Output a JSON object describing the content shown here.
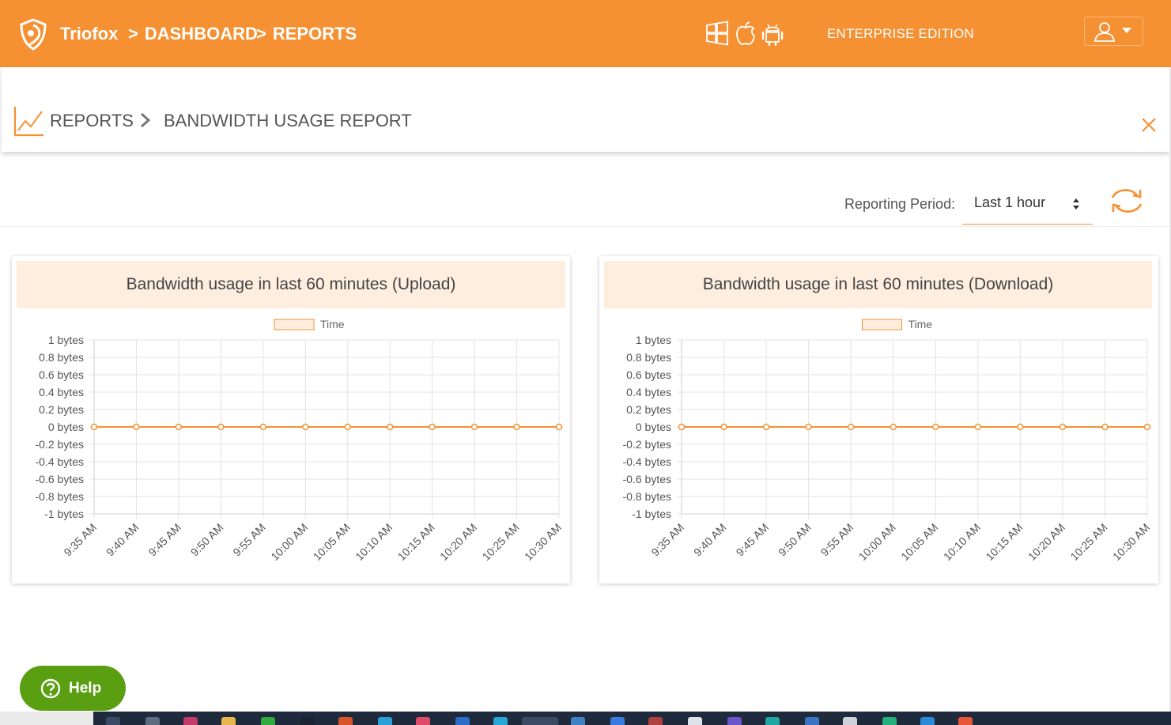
{
  "header": {
    "brand": "Triofox",
    "breadcrumb": [
      "DASHBOARD",
      "REPORTS"
    ],
    "breadcrumb_separator": ">",
    "platform_icons": [
      "windows-icon",
      "apple-icon",
      "android-icon"
    ],
    "edition": "ENTERPRISE EDITION",
    "user_menu_icon": "user-icon"
  },
  "page": {
    "breadcrumb": [
      "REPORTS",
      "BANDWIDTH USAGE REPORT"
    ],
    "icon": "line-chart-icon"
  },
  "toolbar": {
    "reporting_period_label": "Reporting Period:",
    "reporting_period_value": "Last 1 hour",
    "refresh_icon": "refresh-icon"
  },
  "help": {
    "label": "Help"
  },
  "colors": {
    "accent": "#f59132",
    "header_bg": "#f59132",
    "card_head_bg": "#fdeee0",
    "help_green": "#5a9e12",
    "line": "#f59132"
  },
  "chart_data": [
    {
      "type": "line",
      "title": "Bandwidth usage in last 60 minutes (Upload)",
      "x": [
        "9:35 AM",
        "9:40 AM",
        "9:45 AM",
        "9:50 AM",
        "9:55 AM",
        "10:00 AM",
        "10:05 AM",
        "10:10 AM",
        "10:15 AM",
        "10:20 AM",
        "10:25 AM",
        "10:30 AM"
      ],
      "series": [
        {
          "name": "Time",
          "values": [
            0,
            0,
            0,
            0,
            0,
            0,
            0,
            0,
            0,
            0,
            0,
            0
          ]
        }
      ],
      "ylim": [
        -1,
        1
      ],
      "yticks": [
        "1 bytes",
        "0.8 bytes",
        "0.6 bytes",
        "0.4 bytes",
        "0.2 bytes",
        "0 bytes",
        "-0.2 bytes",
        "-0.4 bytes",
        "-0.6 bytes",
        "-0.8 bytes",
        "-1 bytes"
      ],
      "grid": true,
      "legend": "top-center"
    },
    {
      "type": "line",
      "title": "Bandwidth usage in last 60 minutes (Download)",
      "x": [
        "9:35 AM",
        "9:40 AM",
        "9:45 AM",
        "9:50 AM",
        "9:55 AM",
        "10:00 AM",
        "10:05 AM",
        "10:10 AM",
        "10:15 AM",
        "10:20 AM",
        "10:25 AM",
        "10:30 AM"
      ],
      "series": [
        {
          "name": "Time",
          "values": [
            0,
            0,
            0,
            0,
            0,
            0,
            0,
            0,
            0,
            0,
            0,
            0
          ]
        }
      ],
      "ylim": [
        -1,
        1
      ],
      "yticks": [
        "1 bytes",
        "0.8 bytes",
        "0.6 bytes",
        "0.4 bytes",
        "0.2 bytes",
        "0 bytes",
        "-0.2 bytes",
        "-0.4 bytes",
        "-0.6 bytes",
        "-0.8 bytes",
        "-1 bytes"
      ],
      "grid": true,
      "legend": "top-center"
    }
  ]
}
